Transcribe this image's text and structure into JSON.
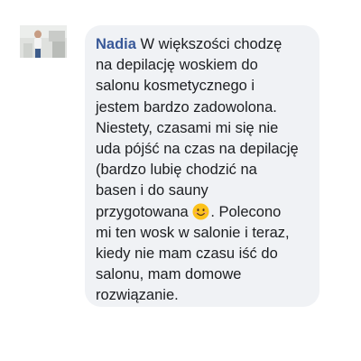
{
  "comment": {
    "author": "Nadia",
    "lines": [
      " W większości chodzę",
      "na depilację woskiem do",
      "salonu kosmetycznego i",
      "jestem bardzo zadowolona.",
      "Niestety, czasami mi się nie",
      "uda pójść na czas na depilację",
      "(bardzo lubię chodzić na",
      "basen i do sauny",
      "przygotowana",
      ". Polecono",
      "mi ten wosk w salonie i teraz,",
      "kiedy nie mam czasu iść do",
      "salonu, mam domowe",
      "rozwiązanie."
    ],
    "emoji": "smiling-face-emoji"
  },
  "colors": {
    "bubble_bg": "#f0f2f5",
    "author": "#385898",
    "text": "#1c1e21"
  }
}
